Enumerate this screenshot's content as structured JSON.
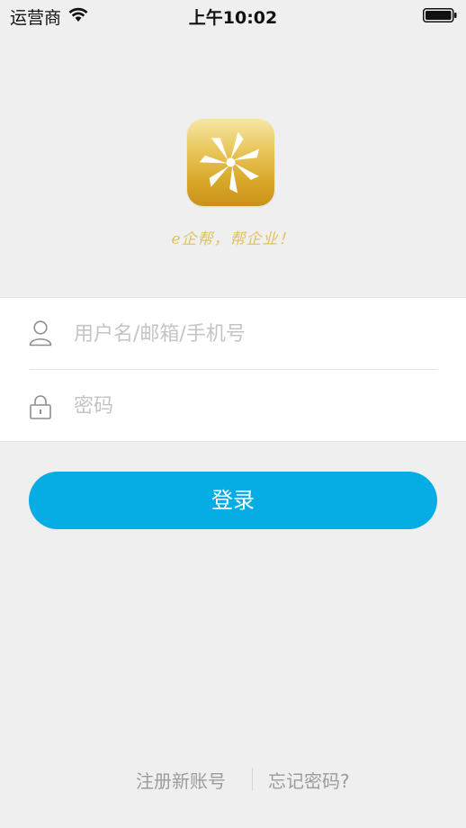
{
  "status_bar": {
    "carrier": "运营商",
    "time": "上午10:02",
    "wifi_icon": "wifi-icon",
    "battery_icon": "battery-icon"
  },
  "brand": {
    "logo_icon": "star-pinwheel-logo",
    "slogan": "e企帮，帮企业！",
    "logo_colors": [
      "#f6e7a6",
      "#d9a92a",
      "#c99217"
    ],
    "slogan_color": "#e0c35f"
  },
  "login_form": {
    "username": {
      "icon": "user-icon",
      "placeholder": "用户名/邮箱/手机号",
      "value": ""
    },
    "password": {
      "icon": "lock-icon",
      "placeholder": "密码",
      "value": ""
    }
  },
  "login_button": {
    "label": "登录",
    "color": "#06ade5"
  },
  "footer": {
    "register_label": "注册新账号",
    "forgot_label": "忘记密码?"
  }
}
